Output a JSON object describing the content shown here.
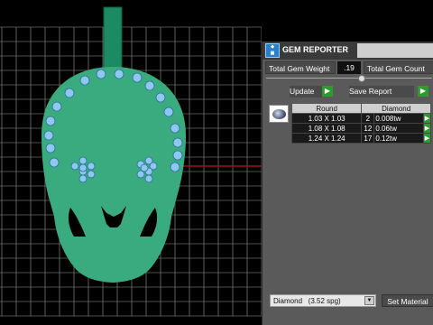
{
  "panel": {
    "title": "GEM REPORTER",
    "total_weight_label": "Total Gem Weight",
    "total_weight_value": ".19",
    "total_count_label": "Total Gem Count",
    "update_label": "Update",
    "save_report_label": "Save Report",
    "table": {
      "headers": [
        "Round",
        "Diamond"
      ],
      "rows": [
        {
          "size": "1.03 X 1.03",
          "count": "2",
          "weight": "0.008tw"
        },
        {
          "size": "1.08 X 1.08",
          "count": "12",
          "weight": "0.06tw"
        },
        {
          "size": "1.24 X 1.24",
          "count": "17",
          "weight": "0.12tw"
        }
      ]
    },
    "material_select": "Diamond   (3.52 spg)",
    "set_material_label": "Set Material"
  },
  "colors": {
    "model": "#3aaa7f",
    "bail": "#1c8a63",
    "gem": "#8ec8ee",
    "grid": "#9a9a9a",
    "axis": "#c01818"
  }
}
